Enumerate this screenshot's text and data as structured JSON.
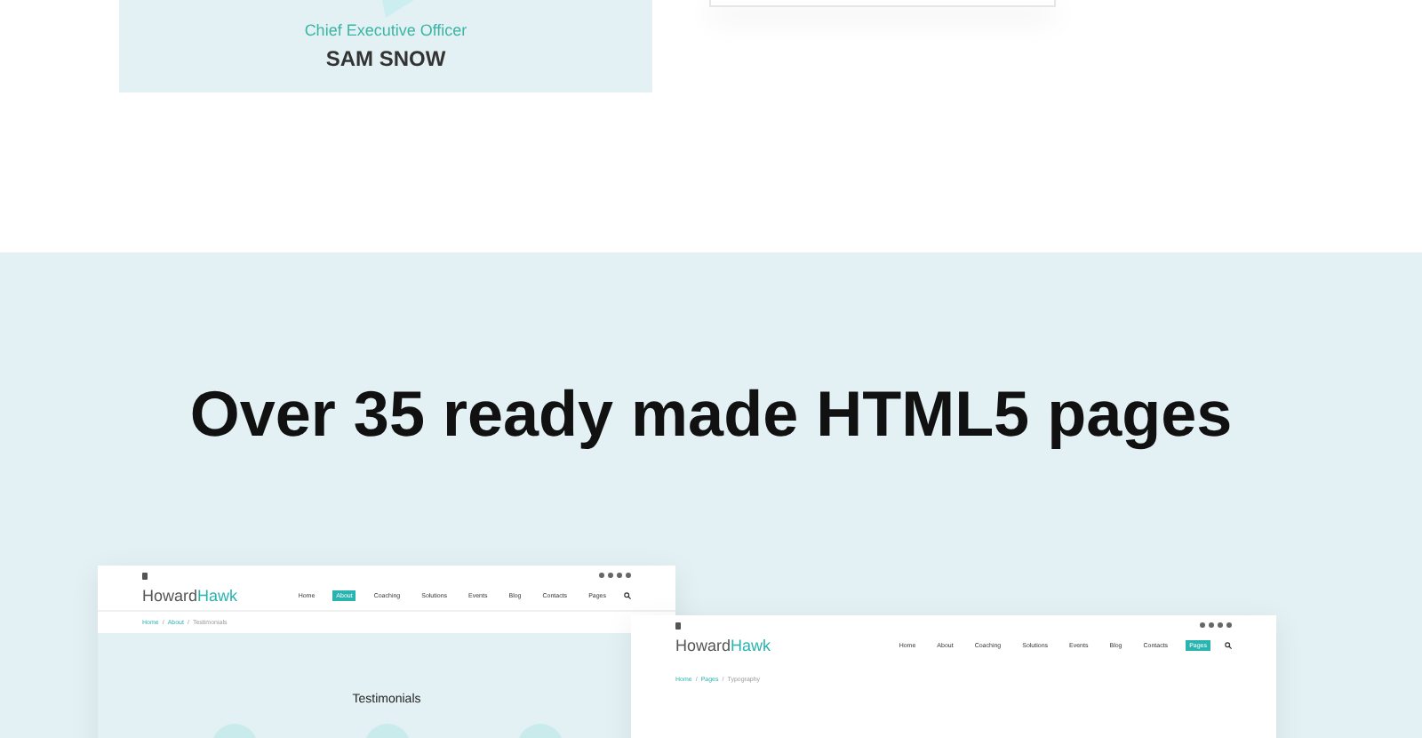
{
  "team_card": {
    "role": "Chief Executive Officer",
    "name": "SAM SNOW"
  },
  "showcase": {
    "heading": "Over 35 ready made HTML5 pages",
    "previews": [
      {
        "logo_first": "Howard",
        "logo_second": "Hawk",
        "nav": [
          {
            "label": "Home",
            "selected": false
          },
          {
            "label": "About",
            "selected": true
          },
          {
            "label": "Coaching",
            "selected": false
          },
          {
            "label": "Solutions",
            "selected": false
          },
          {
            "label": "Events",
            "selected": false
          },
          {
            "label": "Blog",
            "selected": false
          },
          {
            "label": "Contacts",
            "selected": false
          },
          {
            "label": "Pages",
            "selected": false
          }
        ],
        "breadcrumbs": [
          "Home",
          "About",
          "Testimonials"
        ],
        "separator": "/",
        "page_title": "Testimonials",
        "tinted": true
      },
      {
        "logo_first": "Howard",
        "logo_second": "Hawk",
        "nav": [
          {
            "label": "Home",
            "selected": false
          },
          {
            "label": "About",
            "selected": false
          },
          {
            "label": "Coaching",
            "selected": false
          },
          {
            "label": "Solutions",
            "selected": false
          },
          {
            "label": "Events",
            "selected": false
          },
          {
            "label": "Blog",
            "selected": false
          },
          {
            "label": "Contacts",
            "selected": false
          },
          {
            "label": "Pages",
            "selected": true
          }
        ],
        "breadcrumbs": [
          "Home",
          "Pages",
          "Typography"
        ],
        "separator": "/",
        "tinted": false
      }
    ]
  }
}
